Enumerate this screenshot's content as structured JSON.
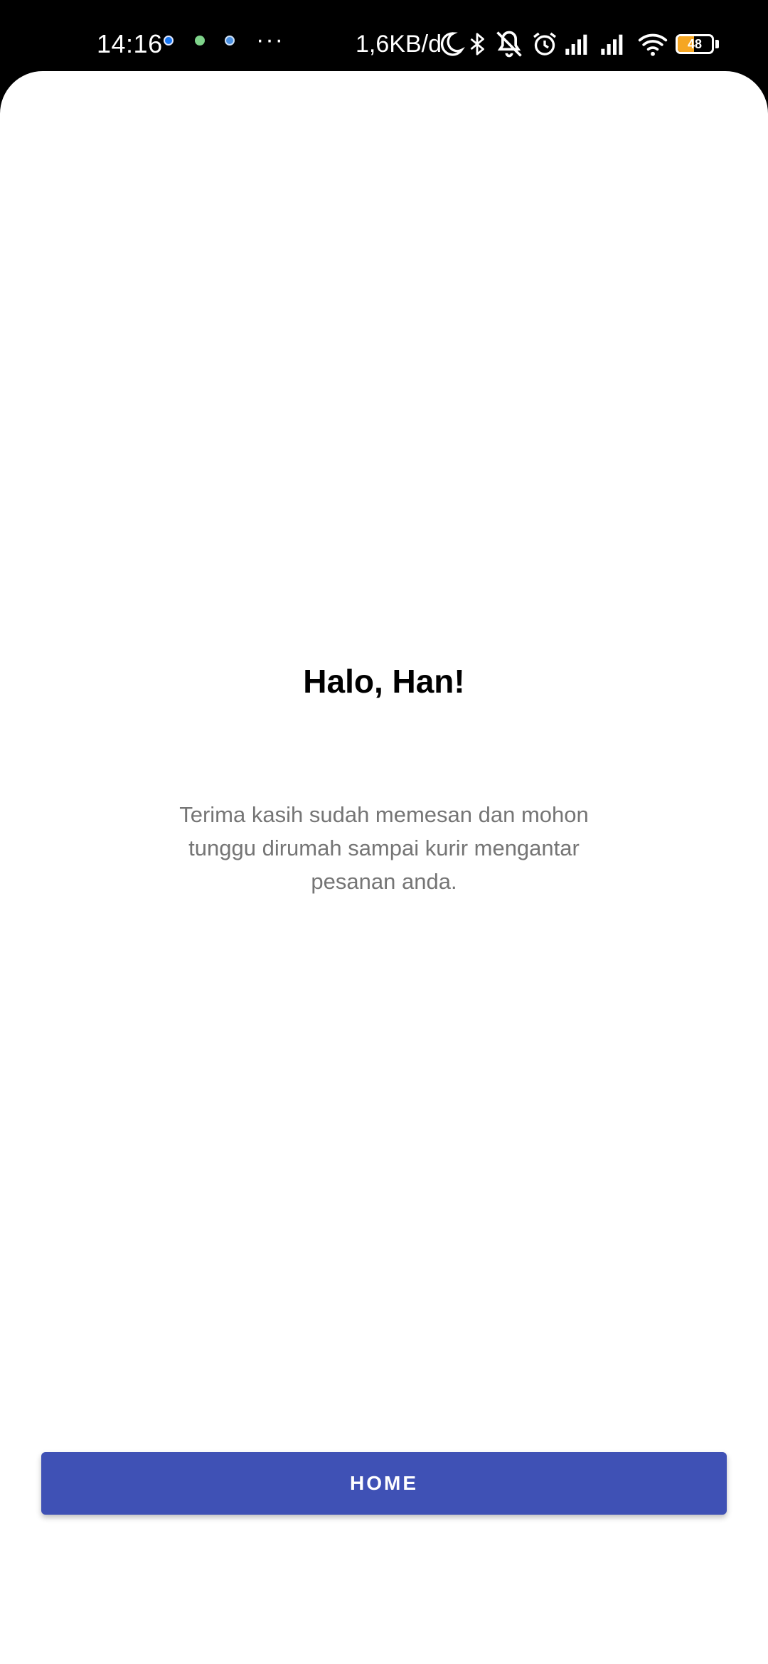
{
  "status_bar": {
    "time": "14:16",
    "more_indicator": "···",
    "network_speed": "1,6KB/d",
    "battery_level": "48",
    "battery_fraction": 0.48,
    "battery_color": "#f5a623",
    "icons": [
      "facebook-notification-icon",
      "green-notification-icon",
      "blue-notification-icon",
      "moon-icon",
      "bluetooth-icon",
      "mute-icon",
      "alarm-icon",
      "signal-icon",
      "signal-icon",
      "wifi-icon",
      "battery-icon"
    ]
  },
  "main": {
    "greeting": "Halo, Han!",
    "message": "Terima kasih sudah memesan dan mohon tunggu dirumah sampai kurir mengantar pesanan anda."
  },
  "button": {
    "label": "HOME",
    "color": "#3f51b5"
  }
}
